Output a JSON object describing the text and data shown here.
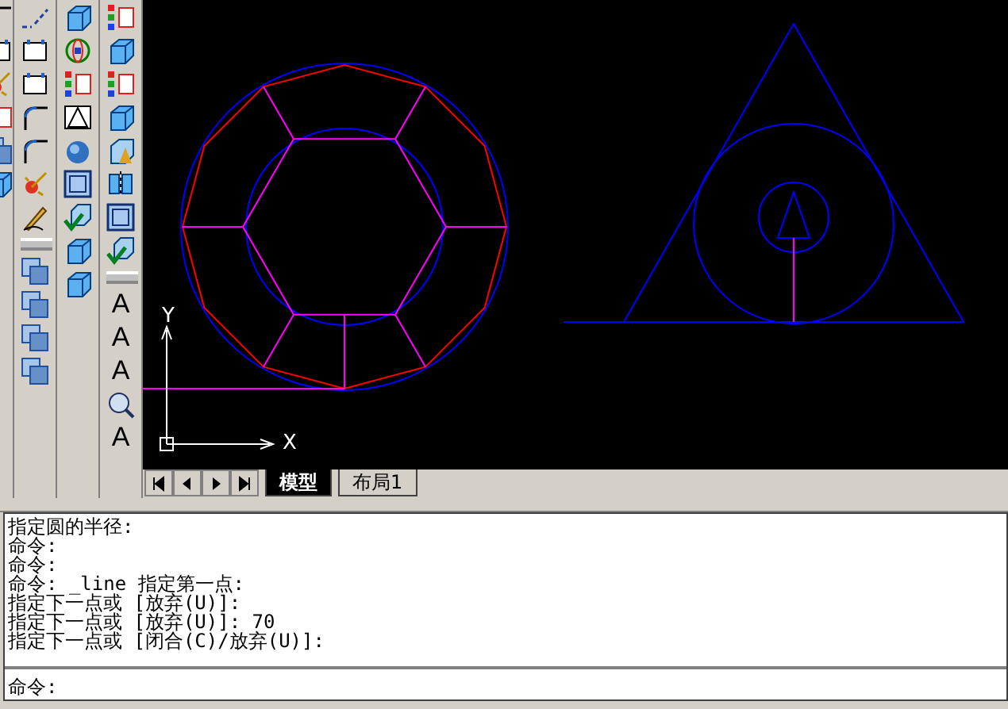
{
  "ucs_icon": {
    "x_label": "X",
    "y_label": "Y"
  },
  "text_toolbar": [
    {
      "glyph": "A"
    },
    {
      "glyph": "A"
    },
    {
      "glyph": "A"
    },
    {
      "glyph": "A"
    }
  ],
  "drawing_tabs": [
    {
      "label": "模型",
      "selected": true
    },
    {
      "label": "布局1",
      "selected": false
    }
  ],
  "command_history": [
    "指定圆的半径:",
    "命令:",
    "命令:",
    "命令: _line 指定第一点:",
    "指定下一点或 [放弃(U)]:",
    "指定下一点或 [放弃(U)]: 70",
    "指定下一点或 [闭合(C)/放弃(U)]:"
  ],
  "command_prompt": "命令:"
}
